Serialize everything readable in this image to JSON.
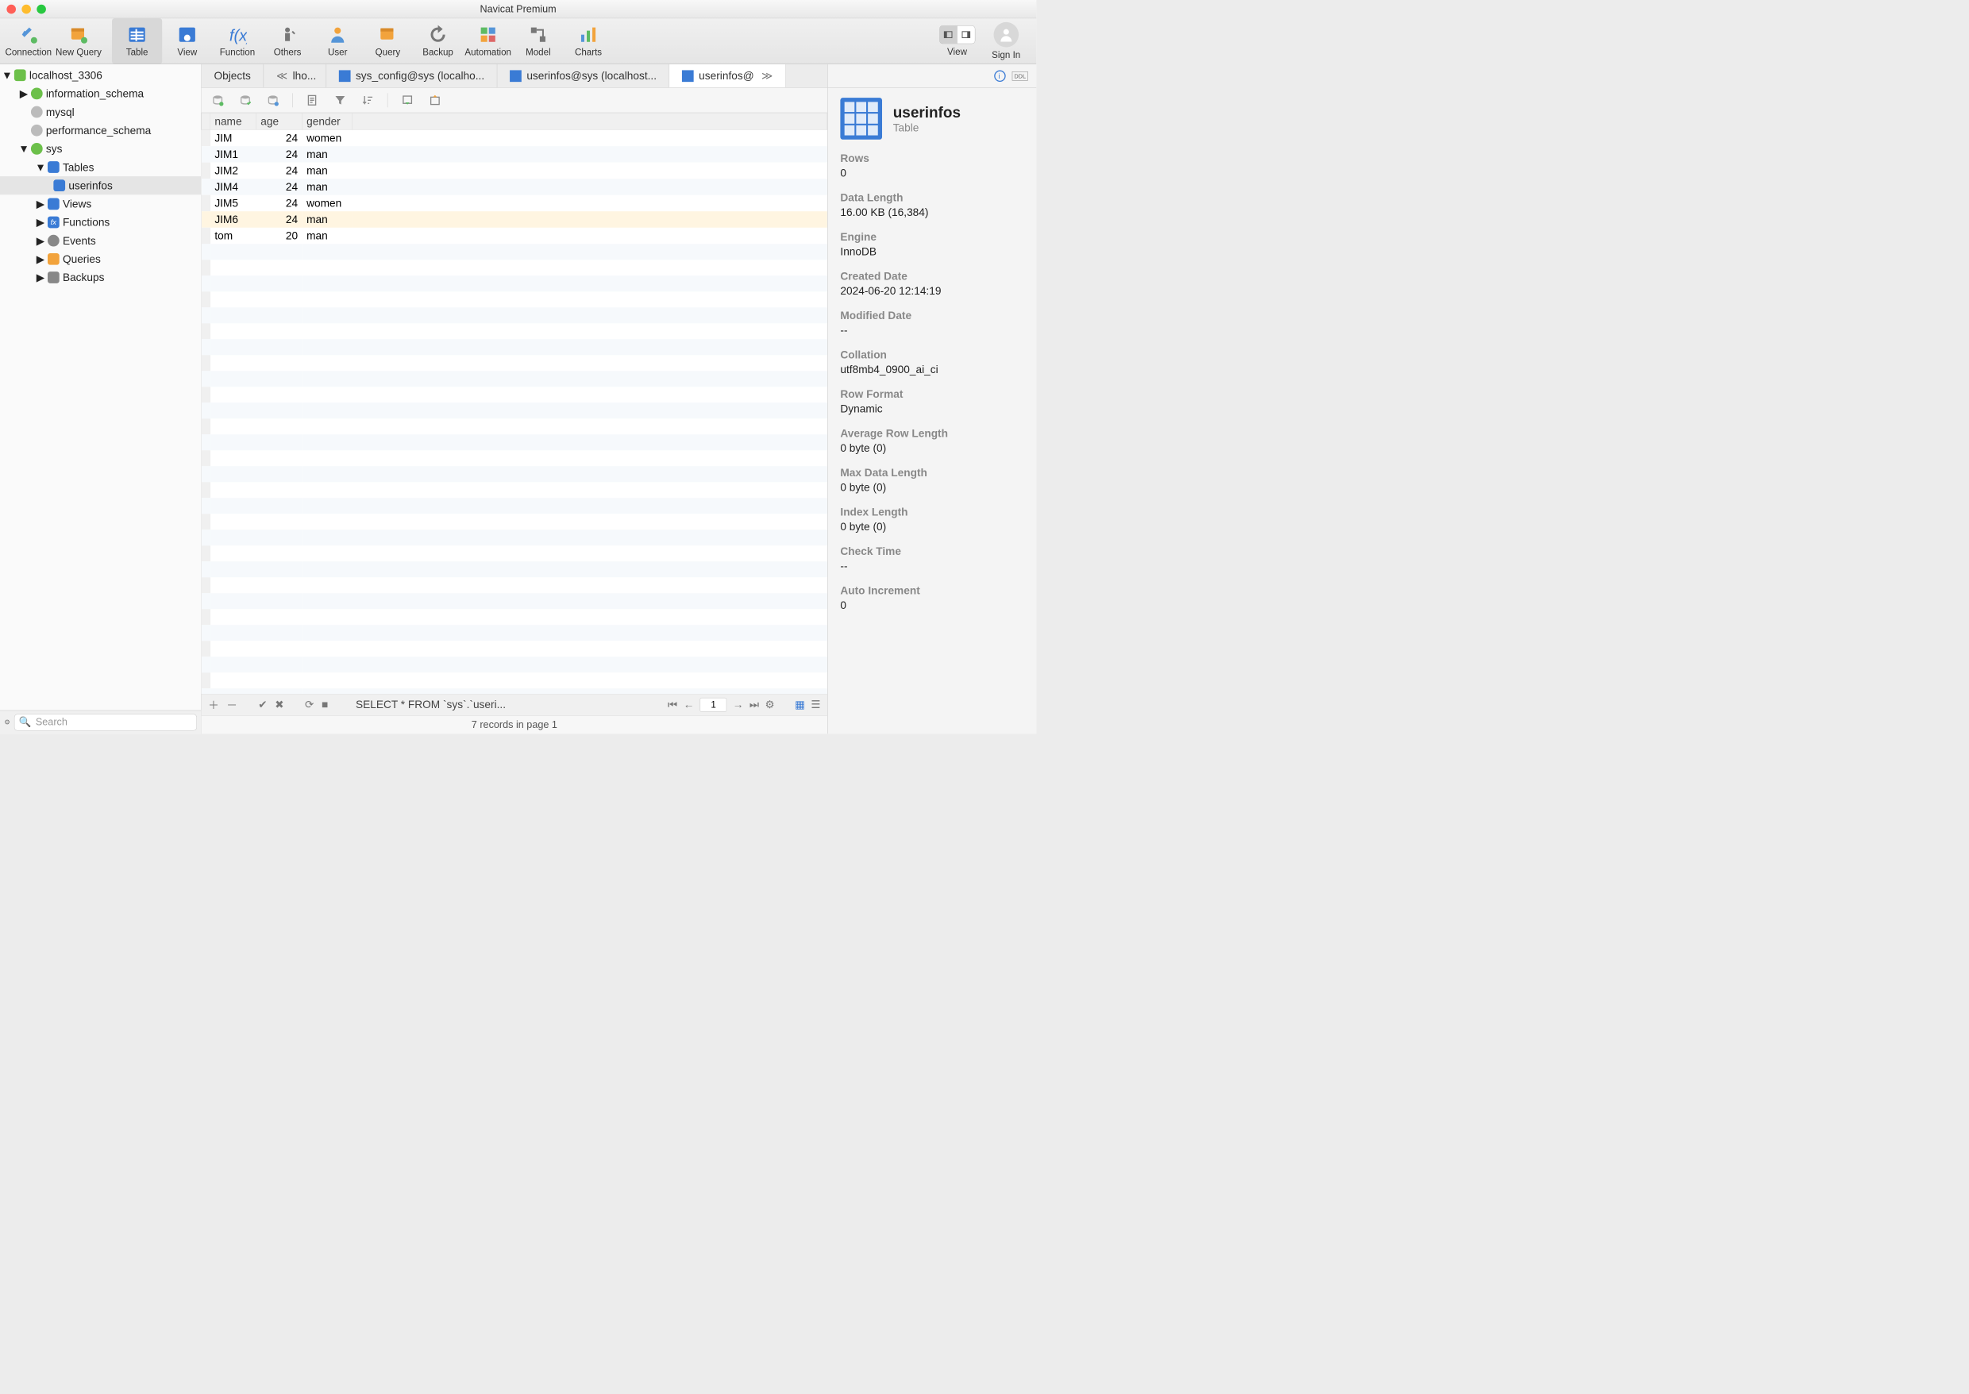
{
  "window": {
    "title": "Navicat Premium"
  },
  "toolbar": {
    "connection": "Connection",
    "new_query": "New Query",
    "table": "Table",
    "view": "View",
    "function": "Function",
    "others": "Others",
    "user": "User",
    "query": "Query",
    "backup": "Backup",
    "automation": "Automation",
    "model": "Model",
    "charts": "Charts",
    "view_right": "View",
    "signin": "Sign In"
  },
  "sidebar": {
    "connection": "localhost_3306",
    "databases": [
      "information_schema",
      "mysql",
      "performance_schema",
      "sys"
    ],
    "sys_children": {
      "tables": "Tables",
      "table_items": [
        "userinfos"
      ],
      "views": "Views",
      "functions": "Functions",
      "events": "Events",
      "queries": "Queries",
      "backups": "Backups"
    },
    "search_placeholder": "Search"
  },
  "tabs": {
    "t0": "Objects",
    "t1": "lho...",
    "t2": "sys_config@sys (localho...",
    "t3": "userinfos@sys (localhost...",
    "t4": "userinfos@"
  },
  "grid": {
    "headers": {
      "name": "name",
      "age": "age",
      "gender": "gender"
    },
    "rows": [
      {
        "name": "JIM",
        "age": "24",
        "gender": "women"
      },
      {
        "name": "JIM1",
        "age": "24",
        "gender": "man"
      },
      {
        "name": "JIM2",
        "age": "24",
        "gender": "man"
      },
      {
        "name": "JIM4",
        "age": "24",
        "gender": "man"
      },
      {
        "name": "JIM5",
        "age": "24",
        "gender": "women"
      },
      {
        "name": "JIM6",
        "age": "24",
        "gender": "man"
      },
      {
        "name": "tom",
        "age": "20",
        "gender": "man"
      }
    ]
  },
  "statusbar": {
    "sql": "SELECT * FROM `sys`.`useri...",
    "page": "1"
  },
  "footer": {
    "status": "7 records in page 1"
  },
  "info": {
    "title": "userinfos",
    "subtitle": "Table",
    "meta": [
      {
        "label": "Rows",
        "value": "0"
      },
      {
        "label": "Data Length",
        "value": "16.00 KB (16,384)"
      },
      {
        "label": "Engine",
        "value": "InnoDB"
      },
      {
        "label": "Created Date",
        "value": "2024-06-20 12:14:19"
      },
      {
        "label": "Modified Date",
        "value": "--"
      },
      {
        "label": "Collation",
        "value": "utf8mb4_0900_ai_ci"
      },
      {
        "label": "Row Format",
        "value": "Dynamic"
      },
      {
        "label": "Average Row Length",
        "value": "0 byte (0)"
      },
      {
        "label": "Max Data Length",
        "value": "0 byte (0)"
      },
      {
        "label": "Index Length",
        "value": "0 byte (0)"
      },
      {
        "label": "Check Time",
        "value": "--"
      },
      {
        "label": "Auto Increment",
        "value": "0"
      }
    ]
  }
}
